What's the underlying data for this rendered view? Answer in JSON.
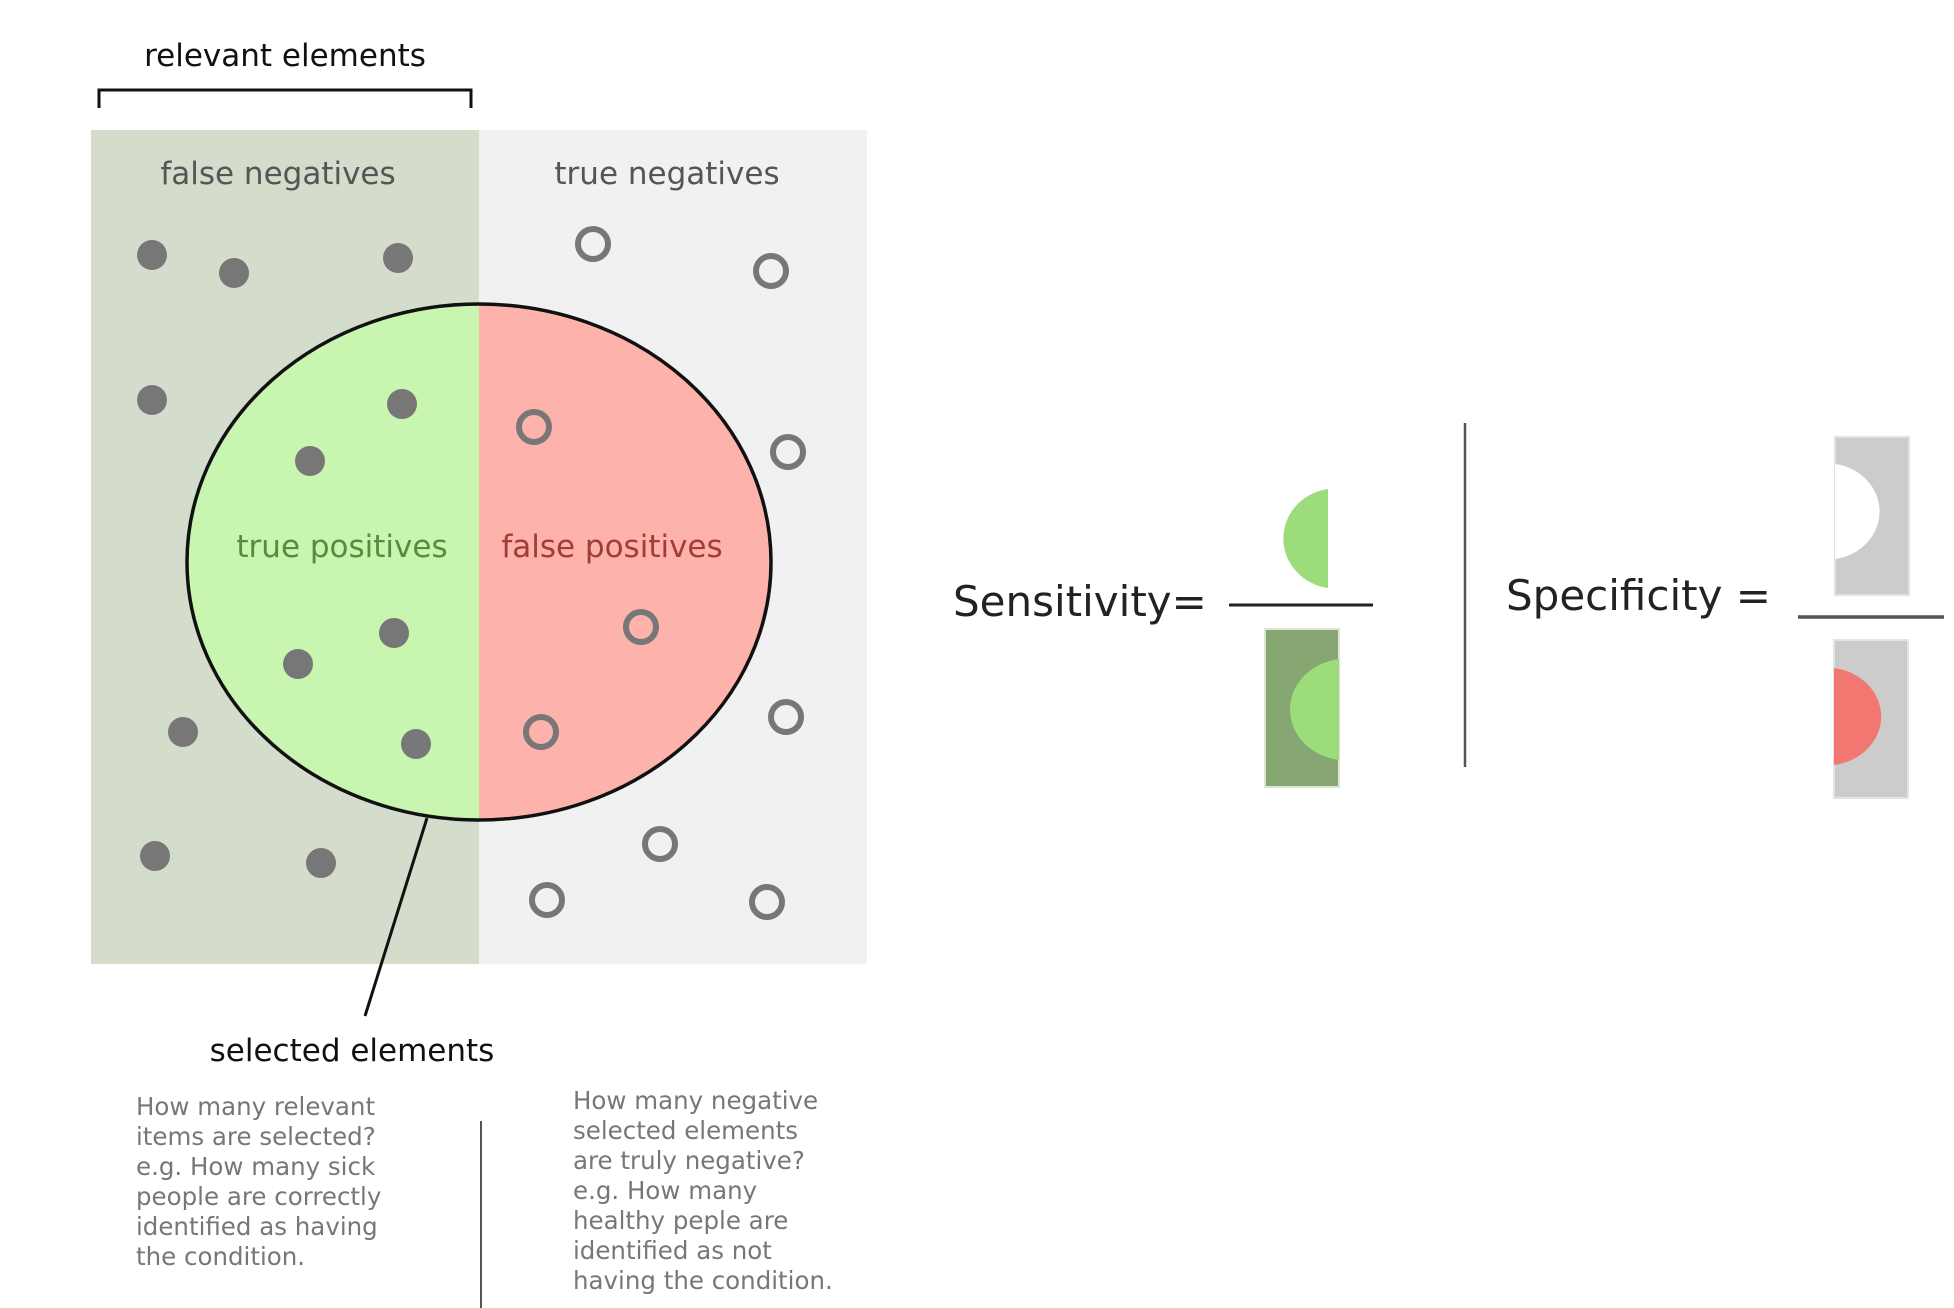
{
  "labels": {
    "relevant": "relevant elements",
    "false_negatives": "false negatives",
    "true_negatives": "true negatives",
    "true_positives": "true positives",
    "false_positives": "false positives",
    "selected": "selected elements"
  },
  "formulas": {
    "sensitivity": "Sensitivity=",
    "specificity": "Specificity ="
  },
  "annotations": {
    "sensitivity_note": "How many relevant\nitems are selected?\ne.g. How many sick\npeople are correctly\nidentified as having\nthe condition.",
    "specificity_note": "How many negative\nselected elements\nare truly negative?\ne.g. How many\nhealthy peple are\nidentified as not\nhaving the condition."
  },
  "colors": {
    "relevant_region": "#d4ddcc",
    "irrelevant_region": "#f1f1f1",
    "true_positive": "#c8f5b0",
    "false_positive": "#fdb2ac",
    "dot": "#777777",
    "green_half": "#9ddc7a",
    "dark_green_box": "#86a771",
    "grey_box": "#cccccc",
    "red_half": "#f27770",
    "tp_text": "#5b8a3c",
    "fp_text": "#a23d36",
    "region_text": "#555555"
  }
}
